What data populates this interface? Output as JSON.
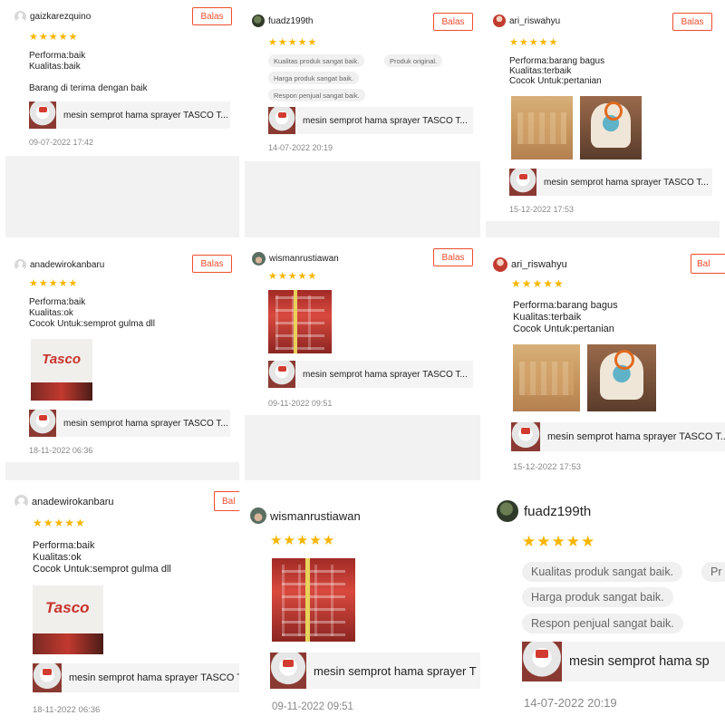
{
  "reply_label": "Balas",
  "star_glyph": "★★★★★",
  "colors": {
    "accent": "#ee4d2d",
    "star": "#f7b500",
    "date": "#888888"
  },
  "reviews": [
    {
      "username": "gaizkarezquino",
      "attributes": [
        "Performa:baik",
        "Kualitas:baik"
      ],
      "comment": "Barang di terima dengan baik",
      "product": "mesin semprot hama sprayer TASCO T...",
      "date": "09-07-2022 17:42"
    },
    {
      "username": "fuadz199th",
      "tags": [
        "Kualitas produk sangat baik.",
        "Produk original.",
        "Harga produk sangat baik.",
        "Respon penjual sangat baik."
      ],
      "product": "mesin semprot hama sprayer TASCO T...",
      "date": "14-07-2022 20:19"
    },
    {
      "username": "ari_riswahyu",
      "attributes": [
        "Performa:barang bagus",
        "Kualitas:terbaik",
        "Cocok Untuk:pertanian"
      ],
      "product": "mesin semprot hama sprayer TASCO T...",
      "date": "15-12-2022 17:53"
    },
    {
      "username": "anadewirokanbaru",
      "attributes": [
        "Performa:baik",
        "Kualitas:ok",
        "Cocok Untuk:semprot gulma dll"
      ],
      "photo_text": "Tasco",
      "product": "mesin semprot hama sprayer TASCO T...",
      "date": "18-11-2022 06:36"
    },
    {
      "username": "wismanrustiawan",
      "product": "mesin semprot hama sprayer TASCO T...",
      "date": "09-11-2022 09:51"
    },
    {
      "username": "ari_riswahyu",
      "attributes": [
        "Performa:barang bagus",
        "Kualitas:terbaik",
        "Cocok Untuk:pertanian"
      ],
      "product": "mesin semprot hama sprayer TASCO T...",
      "date": "15-12-2022 17:53"
    },
    {
      "username": "anadewirokanbaru",
      "attributes": [
        "Performa:baik",
        "Kualitas:ok",
        "Cocok Untuk:semprot gulma dll"
      ],
      "photo_text": "Tasco",
      "product": "mesin semprot hama sprayer TASCO T",
      "date": "18-11-2022 06:36"
    },
    {
      "username": "wismanrustiawan",
      "product": "mesin semprot hama sprayer T",
      "date": "09-11-2022 09:51"
    },
    {
      "username": "fuadz199th",
      "tags": [
        "Kualitas produk sangat baik.",
        "Pr",
        "Harga produk sangat baik.",
        "Respon penjual sangat baik."
      ],
      "product": "mesin semprot hama sp",
      "date": "14-07-2022 20:19"
    }
  ],
  "reply_partial": [
    "Bal",
    "Bal"
  ]
}
